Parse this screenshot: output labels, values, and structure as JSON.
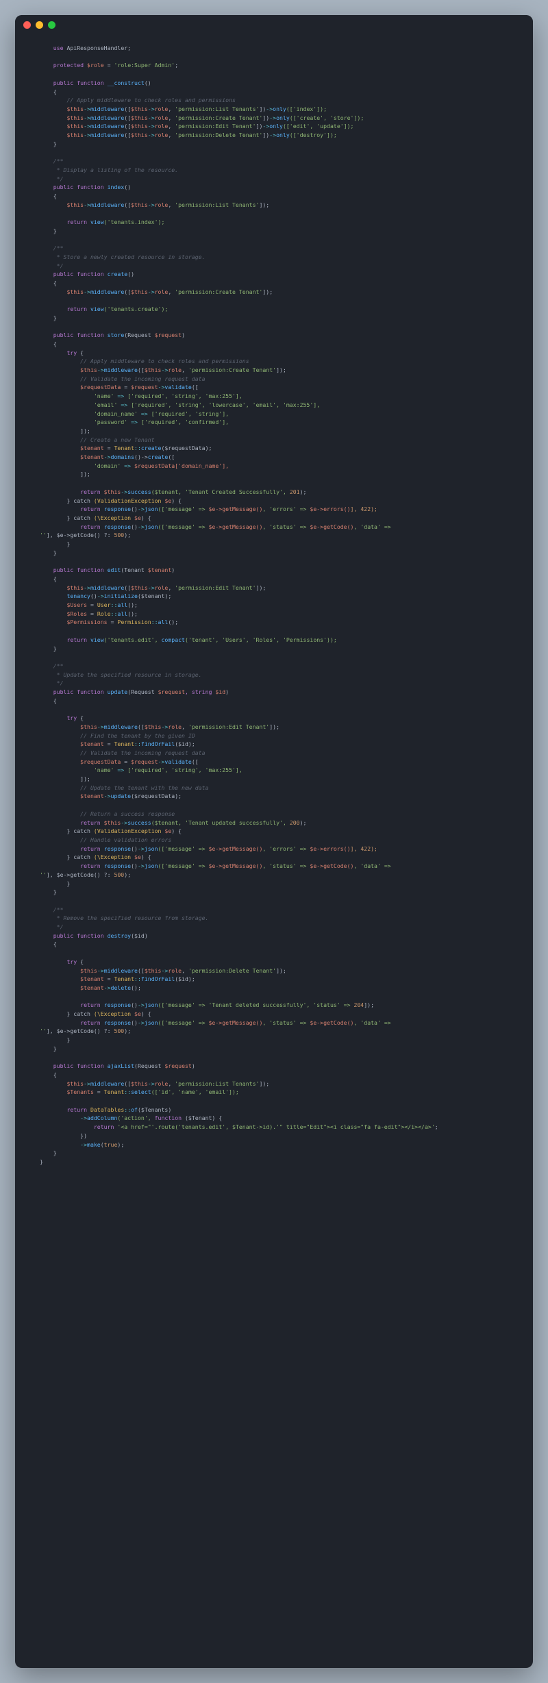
{
  "domain": "Computer-Use",
  "description": "macOS-style code editor window showing PHP Laravel controller source (TenantController)",
  "window": {
    "traffic_lights": [
      "close",
      "minimize",
      "zoom"
    ],
    "bg": "#1f232b",
    "accent_red": "#ff5f57",
    "accent_yellow": "#febc2e",
    "accent_green": "#28c840"
  },
  "syntax_colors": {
    "keyword": "#b477cf",
    "function": "#5ab0f6",
    "variable": "#d6806f",
    "string": "#8fb573",
    "number": "#c9966b",
    "comment": "#5c6370",
    "type": "#d8b25c",
    "operator": "#56b6c2",
    "default": "#abb2bf"
  },
  "t": {
    "use": "use",
    "api_trait": "ApiResponseHandler;",
    "protected": "protected",
    "role_var": "$role",
    "eq": " = ",
    "role_val": "'role:Super Admin'",
    "semi": ";",
    "public": "public",
    "function": "function",
    "construct": "__construct",
    "parens": "()",
    "lbrace": "{",
    "rbrace": "}",
    "cmt_apply": "// Apply middleware to check roles and permissions",
    "this": "$this",
    "arrow": "->",
    "mw": "middleware",
    "mw_open": "([",
    "mw_close": "])",
    "role_prop": "role",
    "perm_list": "'permission:List Tenants'",
    "perm_create": "'permission:Create Tenant'",
    "perm_edit": "'permission:Edit Tenant'",
    "perm_delete": "'permission:Delete Tenant'",
    "only": "only",
    "only_index": "(['index']);",
    "only_create": "(['create', 'store']);",
    "only_edit": "(['edit', 'update']);",
    "only_destroy": "(['destroy']);",
    "doc1a": "/**",
    "doc1b": " * Display a listing of the resource.",
    "doc1c": " */",
    "index": "index",
    "return": "return",
    "view": "view",
    "view_index": "('tenants.index');",
    "doc2b": " * Store a newly created resource in storage.",
    "create": "create",
    "view_create": "('tenants.create');",
    "store": "store",
    "store_sig_a": "(Request ",
    "req_var": "$request",
    "store_sig_b": ")",
    "try": "try",
    "cmt_validate": "// Validate the incoming request data",
    "reqData": "$requestData",
    "validate": "validate",
    "arr_open": "([",
    "name_key": "'name'",
    "fat": " => ",
    "name_rules": "['required', 'string', 'max:255'],",
    "email_key": "'email'",
    "email_rules": "['required', 'string', 'lowercase', 'email', 'max:255'],",
    "domain_key": "'domain_name'",
    "domain_rules": "['required', 'string'],",
    "pwd_key": "'password'",
    "pwd_rules": "['required', 'confirmed'],",
    "arr_close": "]);",
    "cmt_newtenant": "// Create a new Tenant",
    "tenant_var": "$tenant",
    "tenant_cls": "Tenant",
    "scope": "::",
    "tcreate": "create",
    "tcreate_args": "($requestData);",
    "domains": "domains",
    "domains_create_open": "()->",
    "dcreate_open": "create([",
    "domain_idx": "$requestData['domain_name'],",
    "domain_k2": "'domain'",
    "success": "success",
    "succ_created": "($tenant, 'Tenant Created Successfully', ",
    "n201": "201",
    "cparen": ");",
    "catch": "} catch",
    "valex": "(ValidationException ",
    "e": "$e",
    "cp": ") {",
    "resp": "response",
    "json": "json",
    "json_open": "(['message' => ",
    "egetmsg": "$e->getMessage()",
    "err_k": ", 'errors' => ",
    "egeterr": "$e->errors()",
    "n422": "], 422);",
    "exc": "(\\Exception ",
    "status_k": ", 'status' => ",
    "egcode": "$e->getCode()",
    "data_k": ", 'data' => ",
    "emptystr": "''",
    "tern": "], $e->getCode() ?: ",
    "n500": "500",
    "edit": "edit",
    "edit_sig_a": "(Tenant ",
    "tparam": "$tenant",
    "tenancy": "tenancy",
    "initialize": "initialize",
    "init_args": "($tenant);",
    "users_v": "$Users",
    "user_cls": "User",
    "all": "all",
    "all_call": "();",
    "roles_v": "$Roles",
    "role_cls": "Role",
    "perms_v": "$Permissions",
    "perm_cls": "Permission",
    "view_edit": "('tenants.edit', ",
    "compact": "compact",
    "compact_args": "('tenant', 'Users', 'Roles', 'Permissions'));",
    "doc3b": " * Update the specified resource in storage.",
    "update": "update",
    "update_sig_a": "(Request ",
    "str_kw": ", string ",
    "id": "$id",
    "cmt_find": "// Find the tenant by the given ID",
    "findOrFail": "findOrFail",
    "fof_args": "($id);",
    "cmt_validate2": "// Validate the incoming request data",
    "name_rules2": "['required', 'string', 'max:255'],",
    "cmt_updatet": "// Update the tenant with the new data",
    "update_call": "update",
    "upd_arg": "($requestData);",
    "cmt_rsucc": "// Return a success response",
    "succ_updated": "($tenant, 'Tenant updated successfully', ",
    "n200": "200",
    "cmt_handleval": "// Handle validation errors",
    "doc4b": " * Remove the specified resource from storage.",
    "destroy": "destroy",
    "destroy_sig": "($id)",
    "delete": "delete",
    "del_call": "();",
    "del_succ": "(['message' => 'Tenant deleted successfully', 'status' => ",
    "n204": "204",
    "del_end": "]);",
    "ajaxList": "ajaxList",
    "tenants_v": "$Tenants",
    "select": "select",
    "select_args": "(['id', 'name', 'email']);",
    "dt_cls": "DataTables",
    "of": "of",
    "of_args": "($Tenants)",
    "addColumn": "addColumn",
    "addcol_a": "('action', ",
    "fkw": "function",
    "anon_sig": " ($Tenant) {",
    "ret_html_a": "'<a href=\"'.route('tenants.edit', $Tenant->id).'\" title=\"Edit\"><i class=\"fa fa-edit\"></i></a>'",
    "anon_end": "})",
    "make": "make",
    "make_args": "(",
    "true": "true",
    "make_end": ");"
  }
}
